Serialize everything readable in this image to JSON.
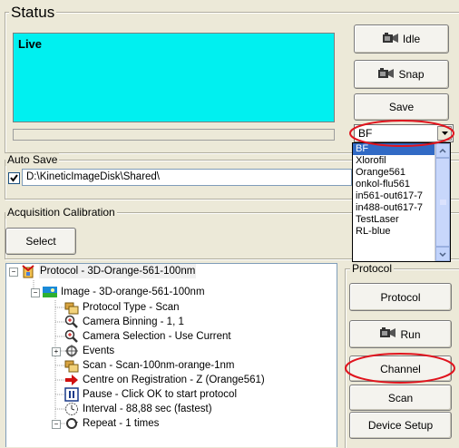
{
  "status": {
    "legend": "Status",
    "display_text": "Live",
    "display_color": "#00f0f0"
  },
  "buttons": {
    "idle": "Idle",
    "snap": "Snap",
    "save": "Save",
    "select": "Select",
    "protocol": "Protocol",
    "run": "Run",
    "channel": "Channel",
    "scan": "Scan",
    "device_setup": "Device Setup"
  },
  "channel_dropdown": {
    "selected": "BF",
    "options": [
      "BF",
      "Xlorofil",
      "Orange561",
      "onkol-flu561",
      "in561-out617-7",
      "in488-out617-7",
      "TestLaser",
      "RL-blue"
    ],
    "highlighted_index": 0
  },
  "auto_save": {
    "legend": "Auto Save",
    "checked": true,
    "path": "D:\\KineticImageDisk\\Shared\\"
  },
  "acquisition_calibration": {
    "legend": "Acquisition Calibration"
  },
  "protocol_group": {
    "legend": "Protocol"
  },
  "tree": {
    "root": "Protocol - 3D-Orange-561-100nm",
    "image": "Image - 3D-orange-561-100nm",
    "items": [
      "Protocol Type - Scan",
      "Camera Binning - 1, 1",
      "Camera Selection - Use Current",
      "Events",
      "Scan - Scan-100nm-orange-1nm",
      "Centre on Registration - Z (Orange561)",
      "Pause - Click OK to start protocol",
      "Interval - 88,88 sec (fastest)",
      "Repeat - 1 times"
    ]
  },
  "colors": {
    "annotation": "#e0141e",
    "selection": "#316ac5"
  }
}
